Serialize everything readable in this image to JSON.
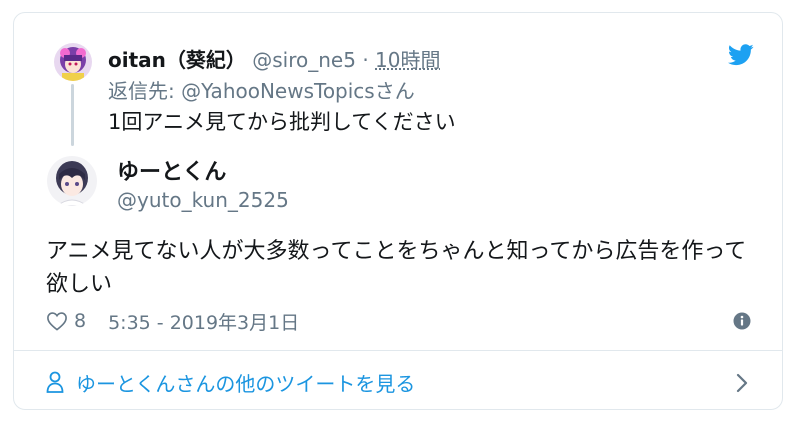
{
  "colors": {
    "brand": "#1da1f2",
    "link": "#1b95e0",
    "secondary_text": "#657786",
    "primary_text": "#14171a",
    "border": "#e1e8ed"
  },
  "icons": {
    "logo": "twitter-bird-icon",
    "like": "heart-icon",
    "info": "info-icon",
    "profile": "person-icon",
    "arrow": "chevron-right-icon"
  },
  "reply_tweet": {
    "display_name": "oitan（葵紀）",
    "handle": "@siro_ne5",
    "separator": "·",
    "time": "10時間",
    "replying_to": "返信先: @YahooNewsTopicsさん",
    "text": "1回アニメ見てから批判してください"
  },
  "main_tweet": {
    "display_name": "ゆーとくん",
    "handle": "@yuto_kun_2525",
    "text": "アニメ見てない人が大多数ってことをちゃんと知ってから広告を作って欲しい",
    "like_count": "8",
    "timestamp": "5:35 - 2019年3月1日"
  },
  "footer": {
    "more_tweets_label": "ゆーとくんさんの他のツイートを見る"
  }
}
